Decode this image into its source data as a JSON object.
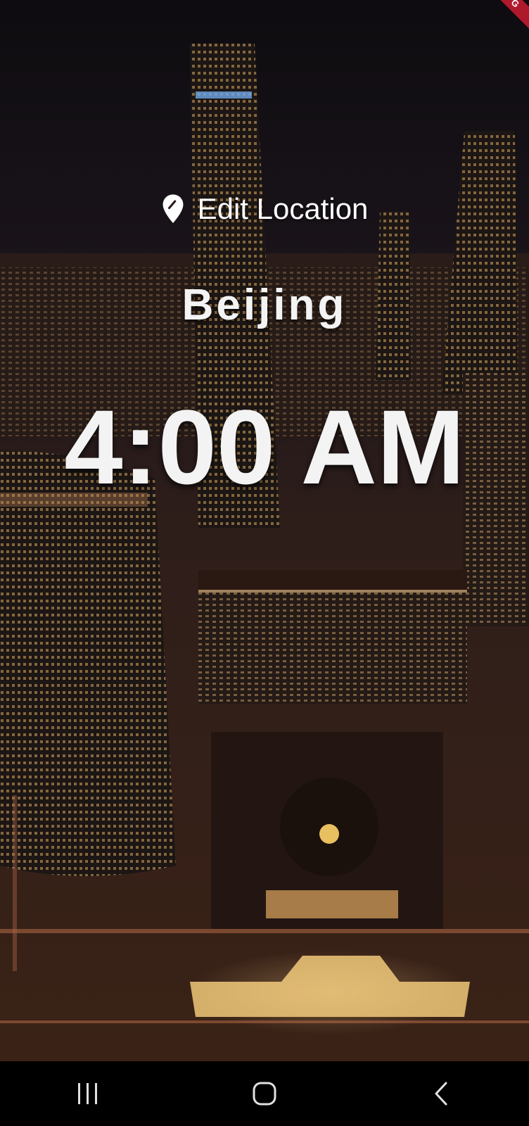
{
  "location": {
    "edit_label": "Edit Location",
    "icon": "map-pin-icon"
  },
  "clock": {
    "city": "Beijing",
    "time": "4:00 AM"
  },
  "banner": {
    "label": "G",
    "color": "#b0182c"
  },
  "nav_bar": {
    "recents_icon": "recents-icon",
    "home_icon": "home-icon",
    "back_icon": "back-icon"
  },
  "background": {
    "description_icon": "city-night-photo",
    "accent": "#e8b060"
  }
}
